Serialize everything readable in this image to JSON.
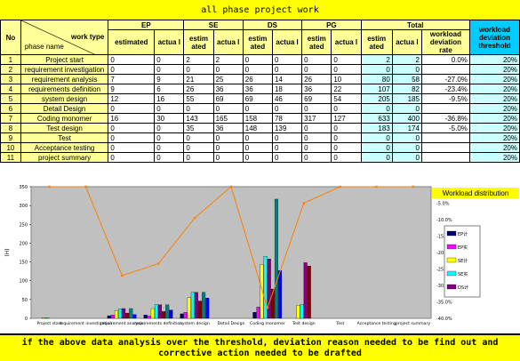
{
  "title": "all phase project work",
  "table": {
    "no_label": "No",
    "work_type_label": "work type",
    "phase_name_label": "phase name",
    "groups": [
      "EP",
      "SE",
      "DS",
      "PG",
      "Total"
    ],
    "subcols": [
      "estimated",
      "actua l",
      "estim ated",
      "actua l",
      "estim ated",
      "actua l",
      "estim ated",
      "actua l",
      "estim ated",
      "actua l"
    ],
    "deviation_header": "workload deviation rate",
    "threshold_header": "workload deviation threshold",
    "rows": [
      {
        "no": "1",
        "phase": "Project start",
        "vals": [
          "0",
          "0",
          "2",
          "2",
          "0",
          "0",
          "0",
          "0"
        ],
        "tot_est": "2",
        "tot_act": "2",
        "dev": "0.0%",
        "thr": "20%"
      },
      {
        "no": "2",
        "phase": "requirement investigation",
        "vals": [
          "0",
          "0",
          "0",
          "0",
          "0",
          "0",
          "0",
          "0"
        ],
        "tot_est": "0",
        "tot_act": "0",
        "dev": "",
        "thr": "20%"
      },
      {
        "no": "3",
        "phase": "requirement analysis",
        "vals": [
          "7",
          "9",
          "21",
          "25",
          "26",
          "14",
          "26",
          "10"
        ],
        "tot_est": "80",
        "tot_act": "58",
        "dev": "-27.0%",
        "thr": "20%"
      },
      {
        "no": "4",
        "phase": "requirements definition",
        "vals": [
          "9",
          "6",
          "26",
          "36",
          "36",
          "18",
          "36",
          "22"
        ],
        "tot_est": "107",
        "tot_act": "82",
        "dev": "-23.4%",
        "thr": "20%"
      },
      {
        "no": "5",
        "phase": "system design",
        "vals": [
          "12",
          "16",
          "55",
          "69",
          "69",
          "46",
          "69",
          "54"
        ],
        "tot_est": "205",
        "tot_act": "185",
        "dev": "-9.5%",
        "thr": "20%"
      },
      {
        "no": "6",
        "phase": "Detail Design",
        "vals": [
          "0",
          "0",
          "0",
          "0",
          "0",
          "0",
          "0",
          "0"
        ],
        "tot_est": "0",
        "tot_act": "0",
        "dev": "",
        "thr": "20%"
      },
      {
        "no": "7",
        "phase": "Coding monomer",
        "vals": [
          "16",
          "30",
          "143",
          "165",
          "158",
          "78",
          "317",
          "127"
        ],
        "tot_est": "633",
        "tot_act": "400",
        "dev": "-36.8%",
        "thr": "20%"
      },
      {
        "no": "8",
        "phase": "Test design",
        "vals": [
          "0",
          "0",
          "35",
          "36",
          "148",
          "139",
          "0",
          "0"
        ],
        "tot_est": "183",
        "tot_act": "174",
        "dev": "-5.0%",
        "thr": "20%"
      },
      {
        "no": "9",
        "phase": "Test",
        "vals": [
          "0",
          "0",
          "0",
          "0",
          "0",
          "0",
          "0",
          "0"
        ],
        "tot_est": "0",
        "tot_act": "0",
        "dev": "",
        "thr": "20%"
      },
      {
        "no": "10",
        "phase": "Acceptance testing",
        "vals": [
          "0",
          "0",
          "0",
          "0",
          "0",
          "0",
          "0",
          "0"
        ],
        "tot_est": "0",
        "tot_act": "0",
        "dev": "",
        "thr": "20%"
      },
      {
        "no": "11",
        "phase": "project summary",
        "vals": [
          "0",
          "0",
          "0",
          "0",
          "0",
          "0",
          "0",
          "0"
        ],
        "tot_est": "0",
        "tot_act": "0",
        "dev": "",
        "thr": "20%"
      }
    ]
  },
  "chart_data": {
    "type": "bar",
    "title": "Workload distribution",
    "categories": [
      "Project start",
      "requirement investigation",
      "requirement analysis",
      "requirements definition",
      "system design",
      "Detail Design",
      "Coding monomer",
      "Test design",
      "Test",
      "Acceptance testing",
      "project summary"
    ],
    "series": [
      {
        "name": "EP",
        "values": [
          0,
          0,
          7,
          9,
          12,
          0,
          16,
          0,
          0,
          0,
          0
        ]
      },
      {
        "name": "EP",
        "values": [
          0,
          0,
          9,
          6,
          16,
          0,
          30,
          0,
          0,
          0,
          0
        ]
      },
      {
        "name": "SE",
        "values": [
          2,
          0,
          21,
          26,
          55,
          0,
          143,
          35,
          0,
          0,
          0
        ]
      },
      {
        "name": "SE",
        "values": [
          2,
          0,
          25,
          36,
          69,
          0,
          165,
          36,
          0,
          0,
          0
        ]
      },
      {
        "name": "DS",
        "values": [
          0,
          0,
          26,
          36,
          69,
          0,
          158,
          148,
          0,
          0,
          0
        ]
      },
      {
        "name": "DS",
        "values": [
          0,
          0,
          14,
          18,
          46,
          0,
          78,
          139,
          0,
          0,
          0
        ]
      },
      {
        "name": "PG",
        "values": [
          0,
          0,
          26,
          36,
          69,
          0,
          317,
          0,
          0,
          0,
          0
        ]
      },
      {
        "name": "PG",
        "values": [
          0,
          0,
          10,
          22,
          54,
          0,
          127,
          0,
          0,
          0,
          0
        ]
      }
    ],
    "deviation_line": [
      0.0,
      null,
      -27.0,
      -23.4,
      -9.5,
      null,
      -36.8,
      -5.0,
      null,
      null,
      null
    ],
    "ylim": [
      0,
      350
    ],
    "yticks": [
      0,
      50,
      100,
      150,
      200,
      250,
      300,
      350
    ],
    "y2lim": [
      -40,
      0
    ],
    "y2ticks": [
      "-5.0%",
      "-10.0%",
      "-15.0%",
      "-20.0%",
      "-25.0%",
      "-30.0%",
      "-35.0%",
      "-40.0%"
    ],
    "ylabel": "(H)",
    "legend_labels": [
      "EP计",
      "EP实",
      "SE计",
      "SE实",
      "DS计"
    ],
    "colors": {
      "bars": [
        "#000080",
        "#ff00ff",
        "#ffff00",
        "#00ffff",
        "#800080",
        "#800000",
        "#008080",
        "#0000ff"
      ],
      "line": "#ff8000",
      "plot_bg": "#c0c0c0"
    }
  },
  "footer": {
    "line1": "if the above data analysis over the threshold, deviation reason needed to be find out and",
    "line2": "corrective action needed to be drafted"
  }
}
